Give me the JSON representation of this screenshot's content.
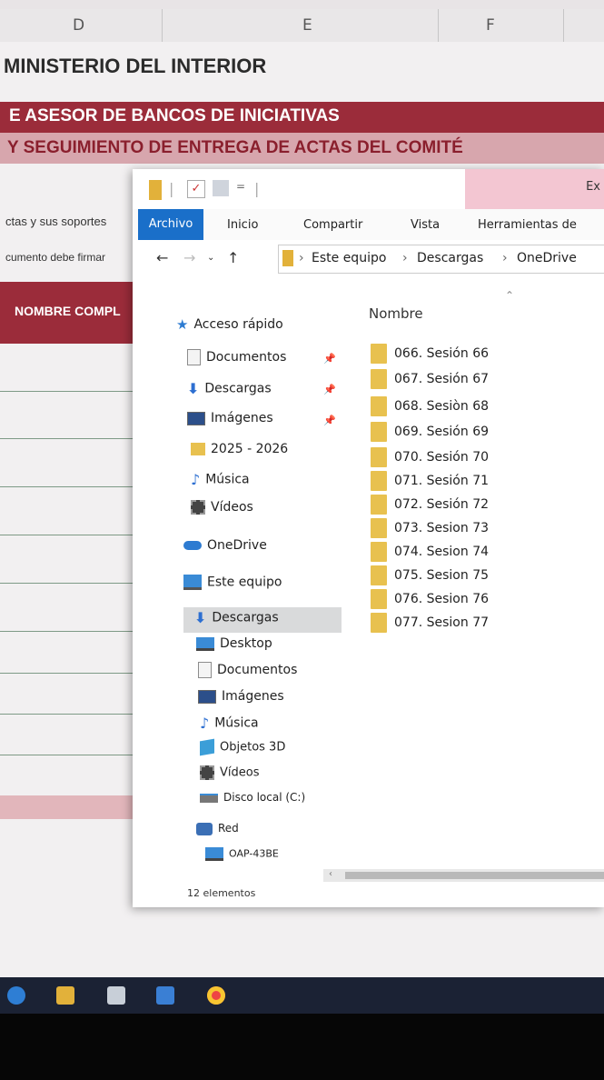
{
  "excel": {
    "columns": [
      "D",
      "E",
      "F"
    ],
    "title": "MINISTERIO DEL INTERIOR",
    "band1": "E ASESOR DE BANCOS DE INICIATIVAS",
    "band2": "Y SEGUIMIENTO DE ENTREGA DE ACTAS DEL COMITÉ",
    "row_text1": "ctas y sus soportes",
    "row_text2": "cumento debe firmar",
    "header_col": "NOMBRE COMPL"
  },
  "explorer": {
    "title_context": "Ex",
    "ribbon_tabs": [
      "Archivo",
      "Inicio",
      "Compartir",
      "Vista",
      "Herramientas de"
    ],
    "breadcrumb": [
      "Este equipo",
      "Descargas",
      "OneDrive"
    ],
    "nav": {
      "quick_access": "Acceso rápido",
      "quick_items": [
        "Documentos",
        "Descargas",
        "Imágenes",
        "2025 - 2026",
        "Música",
        "Vídeos"
      ],
      "onedrive": "OneDrive",
      "this_pc": "Este equipo",
      "pc_items": [
        "Descargas",
        "Desktop",
        "Documentos",
        "Imágenes",
        "Música",
        "Objetos 3D",
        "Vídeos",
        "Disco local (C:)"
      ],
      "network": "Red",
      "network_items": [
        "OAP-43BE"
      ]
    },
    "column_header": "Nombre",
    "files": [
      "066. Sesión 66",
      "067. Sesión 67",
      "068. Sesiòn 68",
      "069. Sesión 69",
      "070. Sesión 70",
      "071. Sesión 71",
      "072. Sesión 72",
      "073. Sesion 73",
      "074. Sesion 74",
      "075. Sesion 75",
      "076. Sesion 76",
      "077. Sesion 77"
    ],
    "status": "12 elementos"
  }
}
